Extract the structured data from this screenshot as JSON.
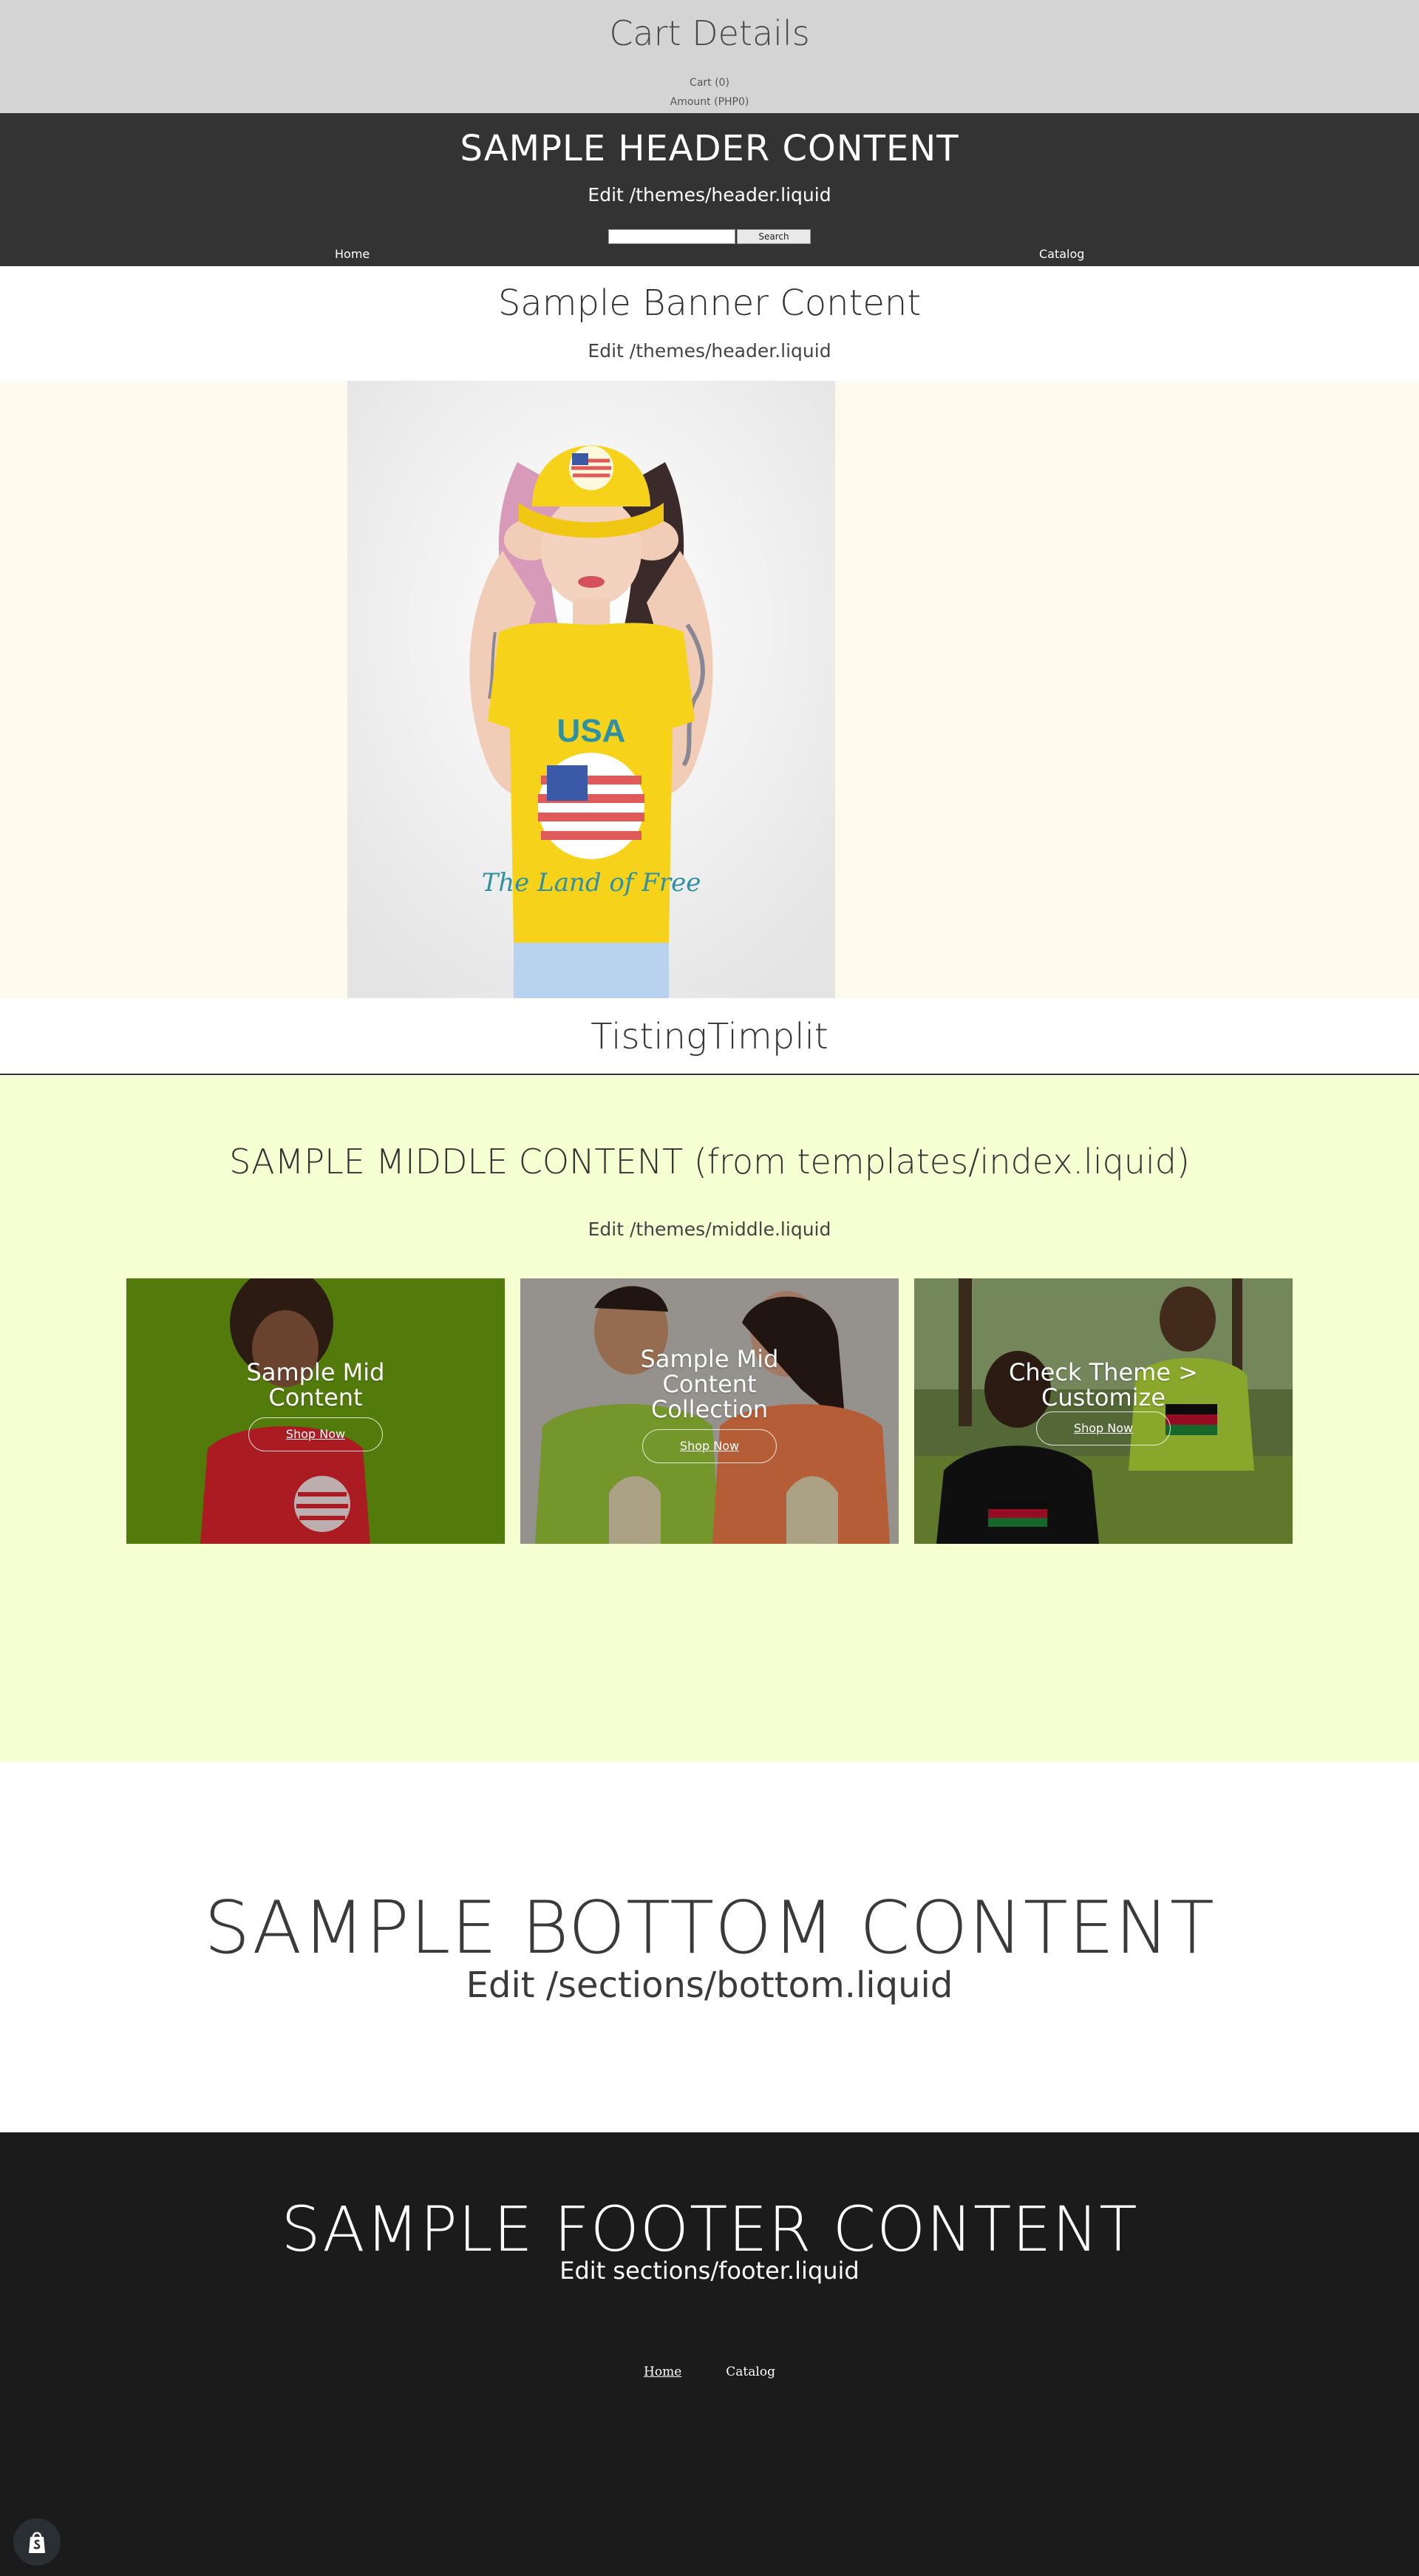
{
  "cart": {
    "title": "Cart Details",
    "count_label": "Cart (0)",
    "amount_label": "Amount (PHP0)"
  },
  "header": {
    "title": "SAMPLE HEADER CONTENT",
    "subtitle": "Edit /themes/header.liquid",
    "search": {
      "placeholder": "",
      "button_label": "Search"
    },
    "nav": [
      {
        "label": "Home"
      },
      {
        "label": "Catalog"
      }
    ]
  },
  "banner": {
    "title": "Sample Banner Content",
    "subtitle": "Edit /themes/header.liquid"
  },
  "hero": {
    "image": "woman-in-yellow-usa-tshirt-and-cap",
    "shirt_text": "USA",
    "shirt_script": "The Land of Free",
    "background": "#fefbee"
  },
  "product": {
    "title": "TistingTimplit"
  },
  "middle": {
    "title": "SAMPLE MIDDLE CONTENT (from templates/index.liquid)",
    "subtitle": "Edit /themes/middle.liquid",
    "background": "#f5ffd2",
    "cards": [
      {
        "title_line1": "Sample Mid",
        "title_line2": "Content",
        "title_line3": "",
        "button_label": "Shop Now",
        "image": "woman-red-tshirt-green-background"
      },
      {
        "title_line1": "Sample Mid",
        "title_line2": "Content",
        "title_line3": "Collection",
        "button_label": "Shop Now",
        "image": "couple-guyana-tshirts"
      },
      {
        "title_line1": "Check Theme >",
        "title_line2": "Customize",
        "title_line3": "",
        "button_label": "Shop Now",
        "image": "father-son-kenya-tshirts"
      }
    ]
  },
  "bottom": {
    "title": "SAMPLE BOTTOM CONTENT",
    "subtitle": "Edit /sections/bottom.liquid"
  },
  "footer": {
    "title": "SAMPLE FOOTER CONTENT",
    "subtitle": "Edit sections/footer.liquid",
    "links": [
      {
        "label": "Home"
      },
      {
        "label": "Catalog"
      }
    ],
    "badge_icon": "shopify-bag-icon"
  },
  "colors": {
    "cart_bar": "#d4d4d4",
    "header_bg": "#333333",
    "footer_bg": "#1b1b1b",
    "shirt_yellow": "#f7d21a"
  }
}
